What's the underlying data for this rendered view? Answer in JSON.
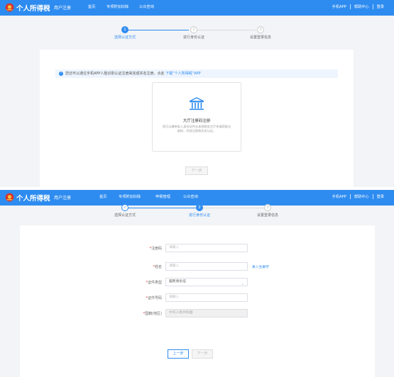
{
  "header": {
    "brand": "个人所得税",
    "subtitle": "用户注册",
    "nav_links_short": [
      "首页",
      "专项附加扣除",
      "公众查询"
    ],
    "nav_links_full": [
      "首页",
      "专项附加扣除",
      "申报管理",
      "公众查询"
    ],
    "mobile_app": "手机APP",
    "help_center": "帮助中心",
    "login": "登录"
  },
  "steps": {
    "items": [
      "选择认证方式",
      "进行身份认证",
      "设置登录信息"
    ],
    "numbers": [
      "1",
      "2",
      "3"
    ],
    "done_check": "✓"
  },
  "screen1": {
    "notice_text": "您还可以通过手机APP人脸识别认证注册来完成实名注册，点此",
    "notice_link": "下载“个人所得税”APP",
    "method_title": "大厅注册码注册",
    "method_desc": "您可以携带本人身份证件去本地税务大厅申请获取注册码，完成注册和实名认证。",
    "next_button": "下一步"
  },
  "screen2": {
    "fields": [
      {
        "label": "注册码",
        "placeholder": "请输入"
      },
      {
        "label": "姓名",
        "placeholder": "请输入",
        "side_link": "录入生僻字"
      },
      {
        "label": "证件类型",
        "value": "居民身份证"
      },
      {
        "label": "证件号码",
        "placeholder": "请输入"
      },
      {
        "label": "国籍(地区)",
        "value": "中华人民共和国"
      }
    ],
    "prev_button": "上一步",
    "next_button": "下一步"
  },
  "colors": {
    "primary": "#2e8cf0",
    "background": "#f2f4f7",
    "required": "#e33333"
  }
}
